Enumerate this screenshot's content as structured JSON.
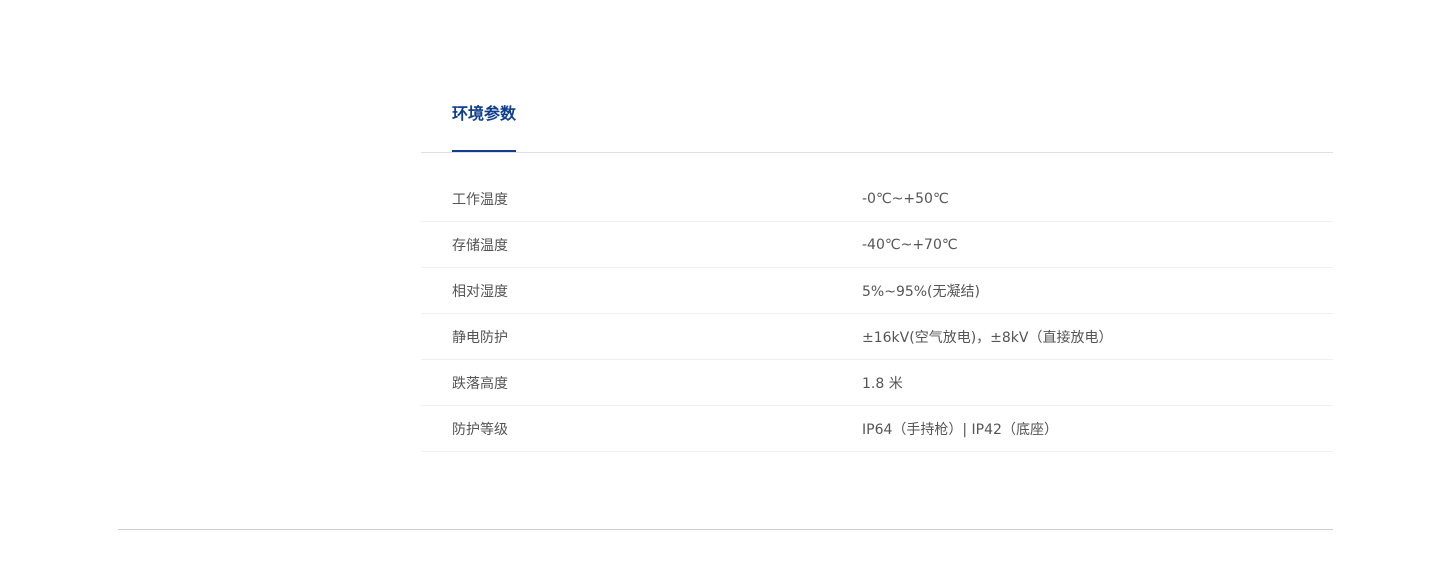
{
  "section": {
    "tab_title": "环境参数",
    "rows": [
      {
        "label": "工作温度",
        "value": "-0℃~+50℃"
      },
      {
        "label": "存储温度",
        "value": "-40℃~+70℃"
      },
      {
        "label": "相对湿度",
        "value": "5%~95%(无凝结)"
      },
      {
        "label": "静电防护",
        "value": "±16kV(空气放电)，±8kV（直接放电）"
      },
      {
        "label": "跌落高度",
        "value": "1.8 米"
      },
      {
        "label": "防护等级",
        "value": "IP64（手持枪）| IP42（底座）"
      }
    ]
  },
  "colors": {
    "accent": "#0f3f8c",
    "text": "#555555",
    "divider": "#dcdfe6"
  }
}
